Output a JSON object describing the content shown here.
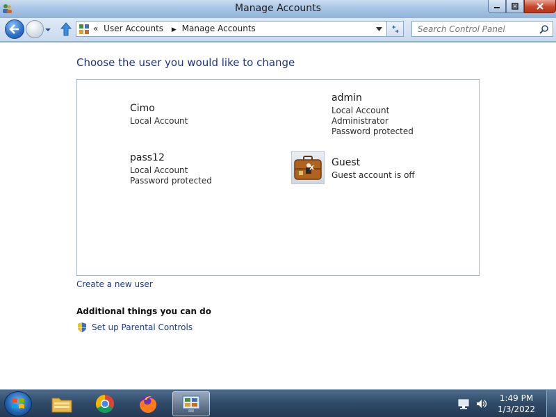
{
  "window": {
    "title": "Manage Accounts"
  },
  "navbar": {
    "breadcrumbs": [
      "User Accounts",
      "Manage Accounts"
    ],
    "overflow_glyph": "«",
    "search_placeholder": "Search Control Panel"
  },
  "content": {
    "heading": "Choose the user you would like to change",
    "users": [
      {
        "name": "Cimo",
        "lines": [
          "Local Account"
        ]
      },
      {
        "name": "admin",
        "lines": [
          "Local Account",
          "Administrator",
          "Password protected"
        ]
      },
      {
        "name": "pass12",
        "lines": [
          "Local Account",
          "Password protected"
        ]
      },
      {
        "name": "Guest",
        "lines": [
          "Guest account is off"
        ]
      }
    ],
    "create_link": "Create a new user",
    "additional_heading": "Additional things you can do",
    "parental_link": "Set up Parental Controls"
  },
  "taskbar": {
    "time": "1:49 PM",
    "date": "1/3/2022",
    "pinned": [
      "windows-explorer",
      "google-chrome",
      "firefox",
      "control-panel"
    ]
  },
  "colors": {
    "heading": "#1e3287",
    "link": "#1e3a8f",
    "close_button": "#c7452b"
  }
}
